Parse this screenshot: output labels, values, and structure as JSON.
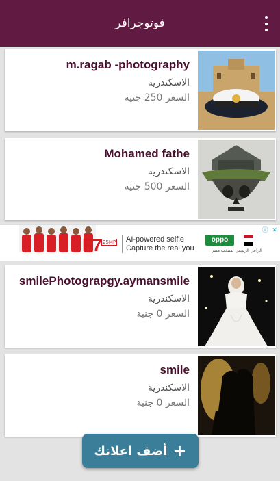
{
  "appbar": {
    "title": "فوتوجرافر",
    "menu_icon": "more-vert-icon"
  },
  "listings": [
    {
      "name": "m.ragab -photography",
      "city": "الاسكندرية",
      "price": "السعر 250 جنية",
      "image": "citadel-captain-hat-photo"
    },
    {
      "name": "Mohamed  fathe",
      "city": "الاسكندرية",
      "price": "السعر 500 جنية",
      "image": "floating-island-skull-photo"
    },
    {
      "name": "smilePhotograpgy.aymansmile",
      "city": "الاسكندرية",
      "price": "السعر 0 جنية",
      "image": "bride-dress-photo"
    },
    {
      "name": "smile",
      "city": "الاسكندرية",
      "price": "السعر 0 جنية",
      "image": "couple-silhouette-photo"
    }
  ],
  "ad": {
    "brand_model": "F7",
    "camera": "25MP",
    "tagline_1": "AI-powered selfie",
    "tagline_2": "Capture the real you",
    "brand": "oppo",
    "sponsor": "الراعي الرسمي لمنتخب مصر"
  },
  "fab": {
    "label": "أضف اعلانك",
    "icon": "plus-icon"
  },
  "colors": {
    "primary": "#611a41",
    "accent": "#3b7e99",
    "background": "#e3e3e3"
  }
}
